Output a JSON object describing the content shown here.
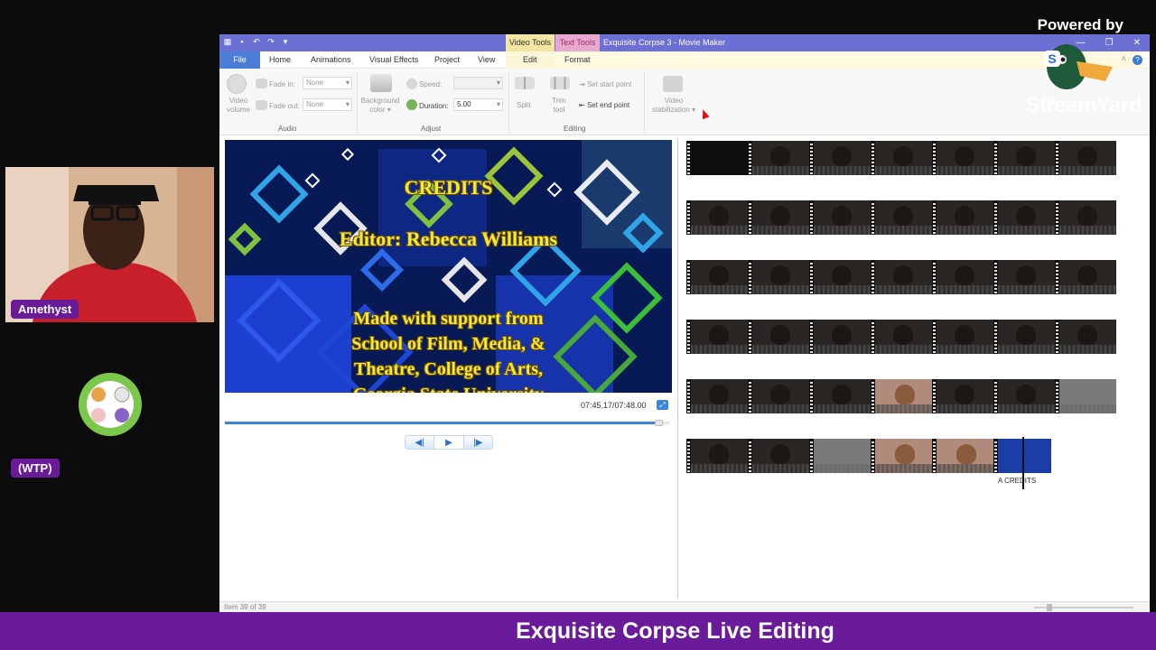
{
  "overlay": {
    "powered_by": "Powered by",
    "brand": "StreamYard",
    "participant_name": "Amethyst",
    "tag": "(WTP)",
    "banner_title": "Exquisite Corpse Live Editing",
    "colors": {
      "banner": "#6a1b9a",
      "badge": "#6a1b9a"
    }
  },
  "window": {
    "title": "Exquisite Corpse 3 - Movie Maker",
    "context_tabs": [
      "Video Tools",
      "Text Tools"
    ],
    "tabs": [
      "File",
      "Home",
      "Animations",
      "Visual Effects",
      "Project",
      "View",
      "Edit",
      "Format"
    ],
    "active_tab": "Edit",
    "colors": {
      "titlebar": "#6c6fd3",
      "file_tab": "#4b7fd6",
      "video_tools": "#f2e6a2",
      "text_tools": "#e8a9ce"
    }
  },
  "ribbon": {
    "audio": {
      "group_label": "Audio",
      "video_volume": "Video\nvolume",
      "fade_in_label": "Fade in:",
      "fade_in_value": "None",
      "fade_out_label": "Fade out:",
      "fade_out_value": "None"
    },
    "adjust": {
      "group_label": "Adjust",
      "background_color": "Background\ncolor ▾",
      "speed_label": "Speed:",
      "speed_value": "",
      "duration_label": "Duration:",
      "duration_value": "5.00"
    },
    "editing": {
      "group_label": "Editing",
      "split": "Split",
      "trim_tool": "Trim\ntool",
      "set_start_point": "Set start point",
      "set_end_point": "Set end point"
    },
    "stabilization": {
      "label": "Video\nstabilization ▾"
    }
  },
  "preview": {
    "title": "CREDITS",
    "editor": "Editor: Rebecca Williams",
    "support_line1": "Made with support from",
    "support_line2": "School of Film, Media, &",
    "support_line3": "Theatre, College of Arts,",
    "support_line4": "Georgia State University",
    "timecode": "07:45.17/07:48.00",
    "progress": 0.98
  },
  "transport": {
    "prev": "◀|",
    "play": "▶",
    "next": "|▶"
  },
  "storyboard": {
    "clip_label": "A CREDITS"
  },
  "status": {
    "text": "Item 39 of 39"
  }
}
